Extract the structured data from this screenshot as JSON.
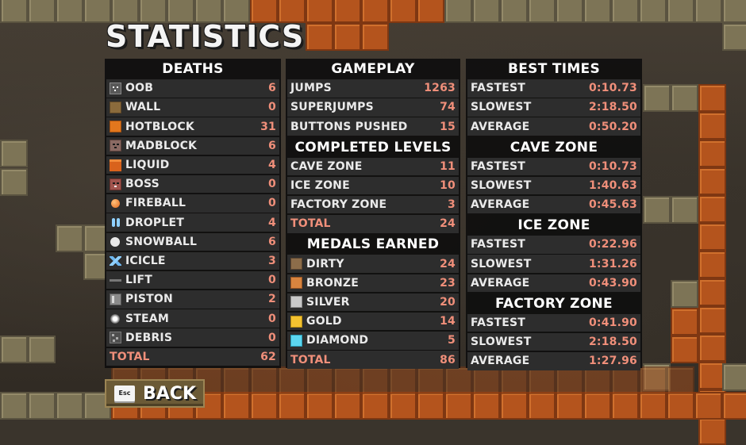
{
  "title": "STATISTICS",
  "deaths": {
    "heading": "DEATHS",
    "rows": [
      {
        "label": "OOB",
        "value": "6",
        "icon": "oob-icon"
      },
      {
        "label": "WALL",
        "value": "0",
        "icon": "wall-icon"
      },
      {
        "label": "HOTBLOCK",
        "value": "31",
        "icon": "hotblock-icon"
      },
      {
        "label": "MADBLOCK",
        "value": "6",
        "icon": "madblock-icon"
      },
      {
        "label": "LIQUID",
        "value": "4",
        "icon": "liquid-icon"
      },
      {
        "label": "BOSS",
        "value": "0",
        "icon": "boss-icon"
      },
      {
        "label": "FIREBALL",
        "value": "0",
        "icon": "fireball-icon"
      },
      {
        "label": "DROPLET",
        "value": "4",
        "icon": "droplet-icon"
      },
      {
        "label": "SNOWBALL",
        "value": "6",
        "icon": "snowball-icon"
      },
      {
        "label": "ICICLE",
        "value": "3",
        "icon": "icicle-icon"
      },
      {
        "label": "LIFT",
        "value": "0",
        "icon": "lift-icon"
      },
      {
        "label": "PISTON",
        "value": "2",
        "icon": "piston-icon"
      },
      {
        "label": "STEAM",
        "value": "0",
        "icon": "steam-icon"
      },
      {
        "label": "DEBRIS",
        "value": "0",
        "icon": "debris-icon"
      }
    ],
    "total_label": "TOTAL",
    "total_value": "62"
  },
  "gameplay": {
    "heading": "GAMEPLAY",
    "rows": [
      {
        "label": "JUMPS",
        "value": "1263"
      },
      {
        "label": "SUPERJUMPS",
        "value": "74"
      },
      {
        "label": "BUTTONS PUSHED",
        "value": "15"
      }
    ]
  },
  "completed_levels": {
    "heading": "COMPLETED LEVELS",
    "rows": [
      {
        "label": "CAVE ZONE",
        "value": "11"
      },
      {
        "label": "ICE ZONE",
        "value": "10"
      },
      {
        "label": "FACTORY ZONE",
        "value": "3"
      }
    ],
    "total_label": "TOTAL",
    "total_value": "24"
  },
  "medals": {
    "heading": "MEDALS EARNED",
    "rows": [
      {
        "label": "DIRTY",
        "value": "24",
        "icon": "dirty-medal-icon"
      },
      {
        "label": "BRONZE",
        "value": "23",
        "icon": "bronze-medal-icon"
      },
      {
        "label": "SILVER",
        "value": "20",
        "icon": "silver-medal-icon"
      },
      {
        "label": "GOLD",
        "value": "14",
        "icon": "gold-medal-icon"
      },
      {
        "label": "DIAMOND",
        "value": "5",
        "icon": "diamond-medal-icon"
      }
    ],
    "total_label": "TOTAL",
    "total_value": "86"
  },
  "best_times": {
    "heading": "BEST TIMES",
    "rows": [
      {
        "label": "FASTEST",
        "value": "0:10.73"
      },
      {
        "label": "SLOWEST",
        "value": "2:18.50"
      },
      {
        "label": "AVERAGE",
        "value": "0:50.20"
      }
    ]
  },
  "cave_zone": {
    "heading": "CAVE ZONE",
    "rows": [
      {
        "label": "FASTEST",
        "value": "0:10.73"
      },
      {
        "label": "SLOWEST",
        "value": "1:40.63"
      },
      {
        "label": "AVERAGE",
        "value": "0:45.63"
      }
    ]
  },
  "ice_zone": {
    "heading": "ICE ZONE",
    "rows": [
      {
        "label": "FASTEST",
        "value": "0:22.96"
      },
      {
        "label": "SLOWEST",
        "value": "1:31.26"
      },
      {
        "label": "AVERAGE",
        "value": "0:43.90"
      }
    ]
  },
  "factory_zone": {
    "heading": "FACTORY ZONE",
    "rows": [
      {
        "label": "FASTEST",
        "value": "0:41.90"
      },
      {
        "label": "SLOWEST",
        "value": "2:18.50"
      },
      {
        "label": "AVERAGE",
        "value": "1:27.96"
      }
    ]
  },
  "back_button": {
    "key_label": "Esc",
    "label": "BACK",
    "key_icon": "esc-key-icon"
  },
  "colors": {
    "value_text": "#f08f7a",
    "panel_bg": "#0e0e0e",
    "row_bg": "#2d2d2d",
    "lava_tile": "#b4541d",
    "stone_tile": "#7d7456"
  }
}
